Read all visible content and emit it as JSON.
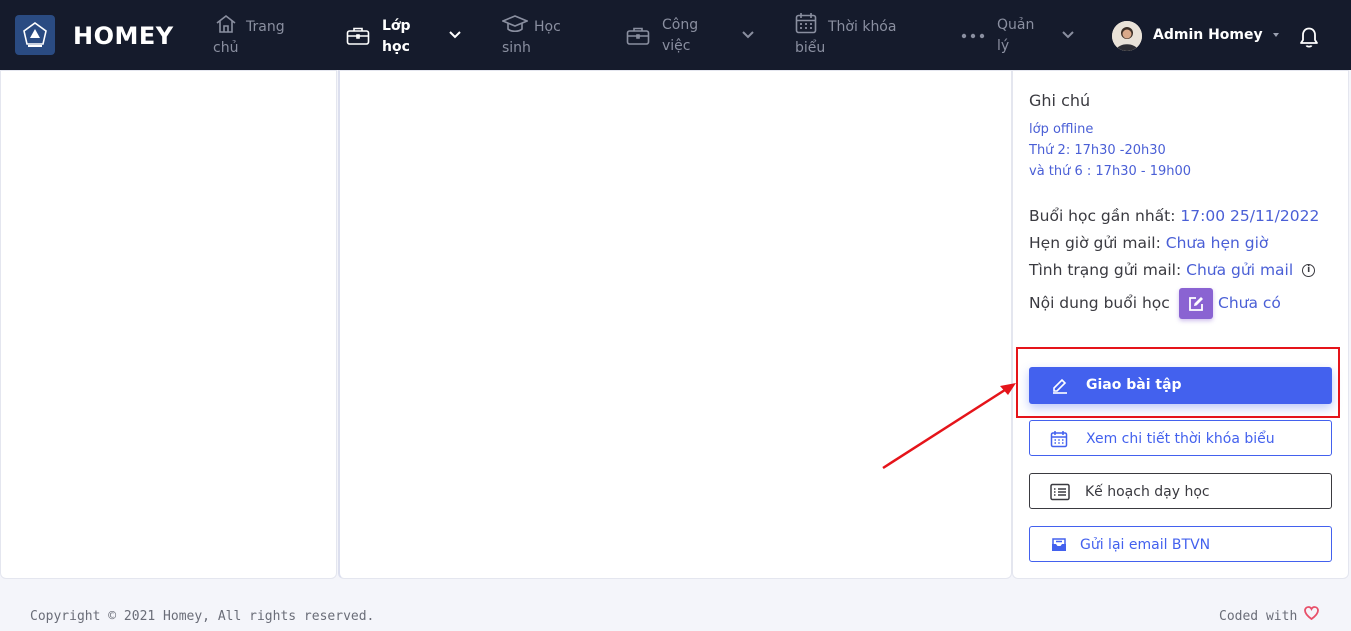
{
  "navbar": {
    "brand": "HOMEY",
    "items": [
      {
        "line1": "Trang",
        "line2": "chủ",
        "icon": "home-icon"
      },
      {
        "line1": "Lớp",
        "line2": "học",
        "icon": "briefcase-icon",
        "active": true
      },
      {
        "line1": "Học",
        "line2": "sinh",
        "icon": "graduation-cap-icon"
      },
      {
        "line1": "Công",
        "line2": "việc",
        "icon": "briefcase-icon"
      },
      {
        "line1": "Thời khóa",
        "line2": "biểu",
        "icon": "calendar-icon"
      },
      {
        "line1": "Quản",
        "line2": "lý",
        "icon": "more-dots-icon"
      }
    ],
    "user_name": "Admin Homey"
  },
  "info": {
    "note_title": "Ghi chú",
    "note_lines": [
      "lớp offline",
      "Thứ 2: 17h30 -20h30",
      "và thứ 6 : 17h30 - 19h00"
    ],
    "nearest_label": "Buổi học gần nhất:",
    "nearest_value": "17:00 25/11/2022",
    "schedule_mail_label": "Hẹn giờ gửi mail:",
    "schedule_mail_value": "Chưa hẹn giờ",
    "mail_status_label": "Tình trạng gửi mail:",
    "mail_status_value": "Chưa gửi mail",
    "content_label": "Nội dung buổi học",
    "content_value": "Chưa có"
  },
  "actions": {
    "assign_homework": "Giao bài tập",
    "view_schedule": "Xem chi tiết thời khóa biểu",
    "teaching_plan": "Kế hoạch dạy học",
    "resend_email": "Gửi lại email BTVN"
  },
  "footer": {
    "copyright": "Copyright © 2021 Homey, All rights reserved.",
    "coded_with": "Coded with"
  },
  "colors": {
    "navbar_bg": "#151b2c",
    "primary": "#4361ee",
    "link": "#4a5fd6",
    "edit_button": "#8a63d2",
    "annotation_red": "#e5141a"
  }
}
